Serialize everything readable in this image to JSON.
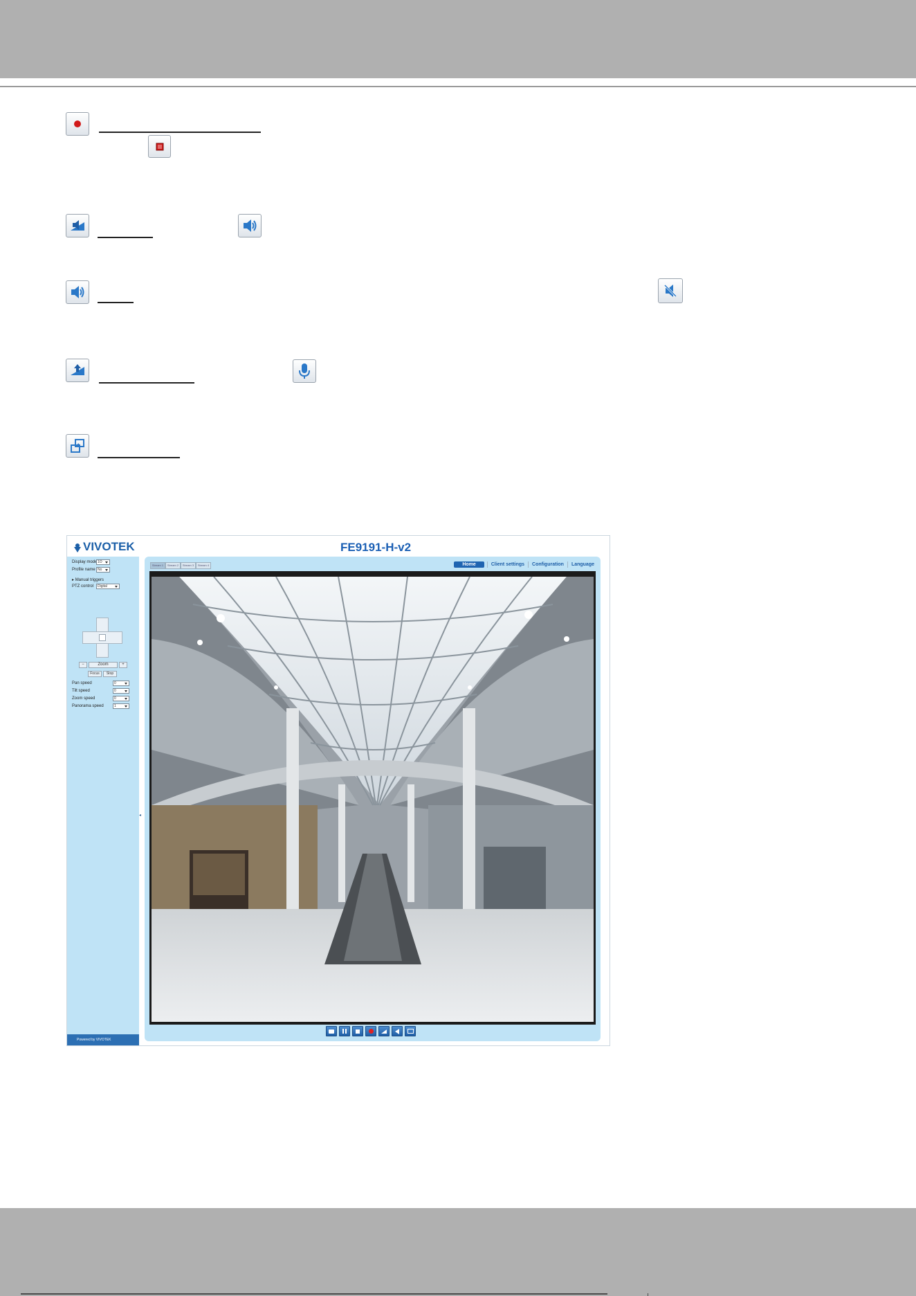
{
  "page": {
    "icon_rows": [
      {
        "name": "record",
        "icon": "record-icon",
        "alt_icon": "stop-record-icon"
      },
      {
        "name": "volume",
        "icon": "volume-down-icon",
        "alt_icon": "speaker-icon"
      },
      {
        "name": "mute",
        "icon": "speaker-icon",
        "alt_icon": "speaker-muted-icon"
      },
      {
        "name": "talk",
        "icon": "talk-icon",
        "alt_icon": "microphone-icon"
      },
      {
        "name": "fullscreen",
        "icon": "fullscreen-icon"
      }
    ]
  },
  "camera_ui": {
    "brand": "VIVOTEK",
    "model": "FE9191-H-v2",
    "stream_tabs": [
      "Stream 1",
      "Stream 2",
      "Stream 3",
      "Stream 4"
    ],
    "nav": {
      "home": "Home",
      "client_settings": "Client settings",
      "configuration": "Configuration",
      "language": "Language"
    },
    "left": {
      "display_mode_label": "Display mode",
      "display_mode_value": "1O",
      "profile_label": "Profile name",
      "profile_value": "No",
      "manual_triggers": "Manual triggers",
      "ptz_control_label": "PTZ control",
      "ptz_control_value": "Digital",
      "zoom_label": "Zoom",
      "zoom_minus": "−",
      "zoom_plus": "+",
      "focus_btn": "Focus",
      "stop_btn": "Stop",
      "pan_speed_label": "Pan speed",
      "pan_speed_value": "0",
      "tilt_speed_label": "Tilt speed",
      "tilt_speed_value": "0",
      "zoom_speed_label": "Zoom speed",
      "zoom_speed_value": "0",
      "panorama_speed_label": "Panorama speed",
      "panorama_speed_value": "1",
      "powered_by": "Powered by VIVOTEK"
    },
    "control_bar_icons": [
      "snapshot-icon",
      "pause-icon",
      "stop-icon",
      "record-icon",
      "volume-icon",
      "speaker-icon",
      "fullscreen-icon"
    ]
  }
}
